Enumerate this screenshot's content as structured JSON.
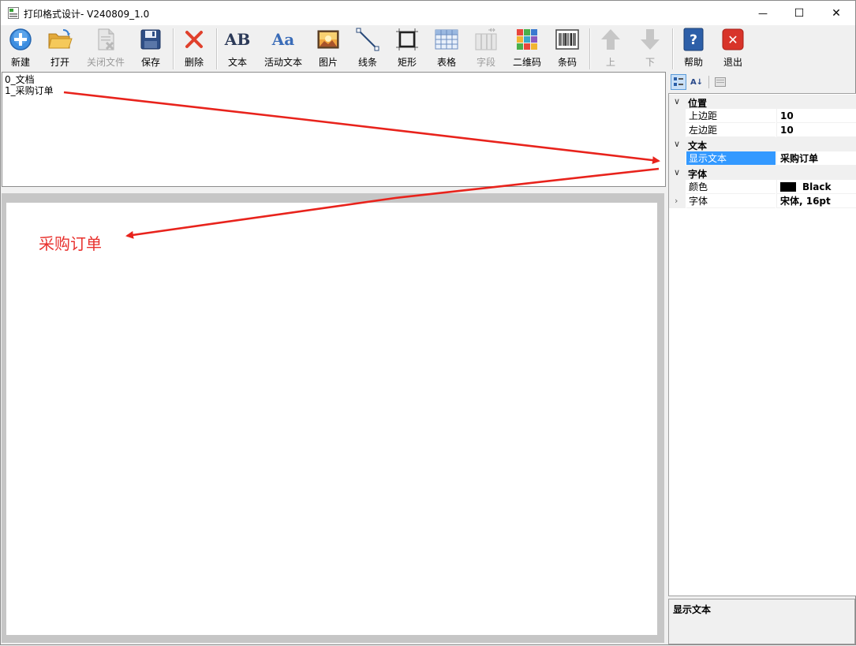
{
  "window": {
    "title": "打印格式设计- V240809_1.0",
    "minimize_glyph": "—",
    "maximize_glyph": "☐",
    "close_glyph": "✕"
  },
  "toolbar": {
    "buttons": [
      {
        "label": "新建",
        "icon": "new-icon",
        "enabled": true
      },
      {
        "label": "打开",
        "icon": "open-folder-icon",
        "enabled": true
      },
      {
        "label": "关闭文件",
        "icon": "close-file-icon",
        "enabled": false
      },
      {
        "label": "保存",
        "icon": "save-icon",
        "enabled": true
      },
      {
        "label": "删除",
        "icon": "delete-icon",
        "enabled": true
      },
      {
        "label": "文本",
        "icon": "text-icon",
        "enabled": true,
        "glyph": "AB"
      },
      {
        "label": "活动文本",
        "icon": "dynamic-text-icon",
        "enabled": true,
        "glyph": "Aa"
      },
      {
        "label": "图片",
        "icon": "image-icon",
        "enabled": true
      },
      {
        "label": "线条",
        "icon": "line-icon",
        "enabled": true
      },
      {
        "label": "矩形",
        "icon": "rectangle-icon",
        "enabled": true
      },
      {
        "label": "表格",
        "icon": "table-icon",
        "enabled": true
      },
      {
        "label": "字段",
        "icon": "field-icon",
        "enabled": false
      },
      {
        "label": "二维码",
        "icon": "qrcode-icon",
        "enabled": true
      },
      {
        "label": "条码",
        "icon": "barcode-icon",
        "enabled": true
      },
      {
        "label": "上",
        "icon": "arrow-up-icon",
        "enabled": false
      },
      {
        "label": "下",
        "icon": "arrow-down-icon",
        "enabled": false
      },
      {
        "label": "帮助",
        "icon": "help-icon",
        "enabled": true,
        "glyph": "?"
      },
      {
        "label": "退出",
        "icon": "exit-icon",
        "enabled": true,
        "glyph": "✕"
      }
    ]
  },
  "tree": {
    "nodes": [
      "0_文档",
      "1_采购订单"
    ]
  },
  "canvas": {
    "text": "采购订单",
    "text_color": "#e8322e"
  },
  "property_grid": {
    "tool_glyphs": {
      "az": "A↓"
    },
    "categories": [
      {
        "name": "位置",
        "expanded": true,
        "props": [
          {
            "name": "上边距",
            "value": "10"
          },
          {
            "name": "左边距",
            "value": "10"
          }
        ]
      },
      {
        "name": "文本",
        "expanded": true,
        "props": [
          {
            "name": "显示文本",
            "value": "采购订单",
            "selected": true
          }
        ]
      },
      {
        "name": "字体",
        "expanded": true,
        "props": [
          {
            "name": "颜色",
            "value": "Black",
            "swatch": "#000000"
          },
          {
            "name": "字体",
            "value": "宋体, 16pt",
            "expandable": true
          }
        ]
      }
    ],
    "description_title": "显示文本"
  },
  "annotation": {
    "arrow_color": "#e8231c"
  }
}
